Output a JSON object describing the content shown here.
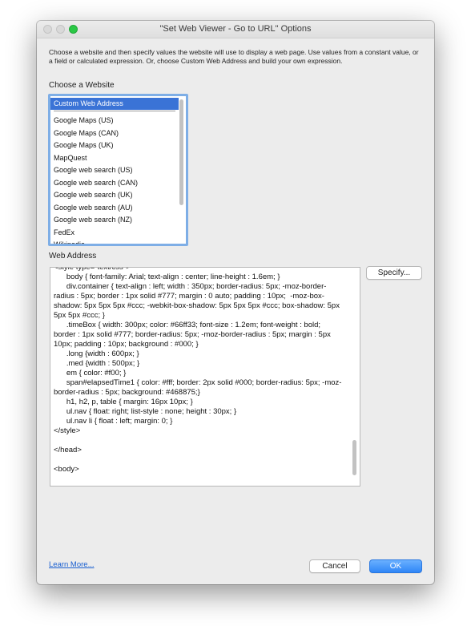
{
  "window": {
    "title": "\"Set Web Viewer - Go to URL\" Options"
  },
  "description": "Choose a website and then specify values the website will use to display a web page. Use values from a constant value, or a field or calculated expression. Or, choose Custom Web Address and build your own expression.",
  "website_section": {
    "label": "Choose a Website",
    "items": [
      {
        "label": "Custom Web Address"
      },
      {
        "label": "Google Maps (US)"
      },
      {
        "label": "Google Maps (CAN)"
      },
      {
        "label": "Google Maps (UK)"
      },
      {
        "label": "MapQuest"
      },
      {
        "label": "Google web search (US)"
      },
      {
        "label": "Google web search (CAN)"
      },
      {
        "label": "Google web search (UK)"
      },
      {
        "label": "Google web search (AU)"
      },
      {
        "label": "Google web search (NZ)"
      },
      {
        "label": "FedEx"
      },
      {
        "label": "Wikipedia"
      }
    ]
  },
  "web_address": {
    "label": "Web Address",
    "content": "<style type=\"text/css\">\n      body { font-family: Arial; text-align : center; line-height : 1.6em; }\n      div.container { text-align : left; width : 350px; border-radius: 5px; -moz-border-radius : 5px; border : 1px solid #777; margin : 0 auto; padding : 10px;  -moz-box-shadow: 5px 5px 5px #ccc; -webkit-box-shadow: 5px 5px 5px #ccc; box-shadow: 5px 5px 5px #ccc; }\n      .timeBox { width: 300px; color: #66ff33; font-size : 1.2em; font-weight : bold; border : 1px solid #777; border-radius: 5px; -moz-border-radius : 5px; margin : 5px 10px; padding : 10px; background : #000; }\n      .long {width : 600px; }\n      .med {width : 500px; }\n      em { color: #f00; }\n      span#elapsedTime1 { color: #fff; border: 2px solid #000; border-radius: 5px; -moz-border-radius : 5px; background: #468875;}\n      h1, h2, p, table { margin: 16px 10px; }\n      ul.nav { float: right; list-style : none; height : 30px; }\n      ul.nav li { float : left; margin: 0; }\n</style>\n\n</head>\n\n<body>"
  },
  "buttons": {
    "specify": "Specify...",
    "cancel": "Cancel",
    "ok": "OK"
  },
  "learn_more": "Learn More..."
}
